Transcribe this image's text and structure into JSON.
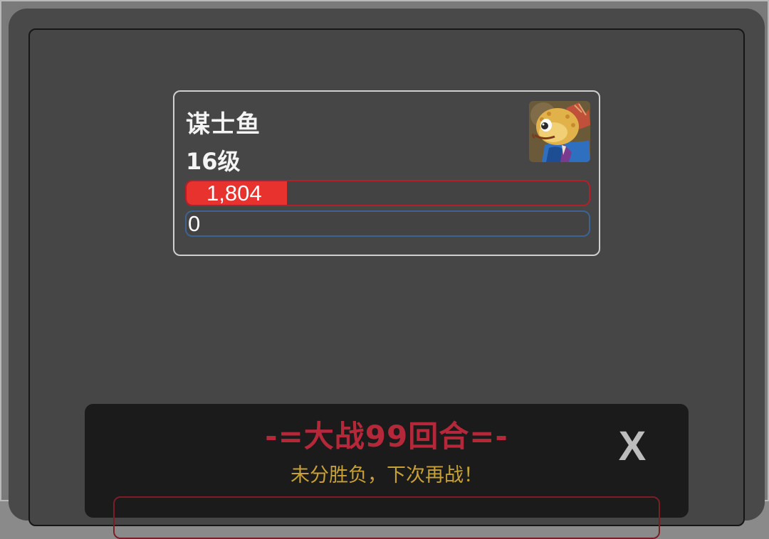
{
  "unit": {
    "name": "谋士鱼",
    "level": "16级",
    "hp_text": "1,804",
    "hp_fraction": 0.25,
    "mp_text": "0",
    "mp_fraction": 0,
    "portrait_icon": "fish-strategist-portrait-icon"
  },
  "battle_result": {
    "title": "-=大战99回合=-",
    "subtitle": "未分胜负，下次再战！",
    "close_label": "X"
  },
  "colors": {
    "hp_fill": "#e8322d",
    "hp_border": "#b3202a",
    "mp_border": "#3c6391",
    "title_red": "#b5283a",
    "subtitle_gold": "#c8a035"
  }
}
